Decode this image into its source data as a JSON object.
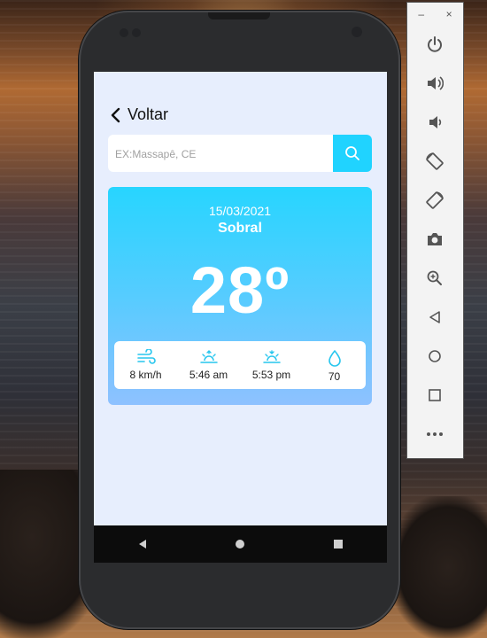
{
  "app": {
    "back_label": "Voltar",
    "search": {
      "placeholder": "EX:Massapê, CE",
      "value": ""
    },
    "weather": {
      "date": "15/03/2021",
      "city": "Sobral",
      "temperature": "28º",
      "stats": [
        {
          "icon": "wind-icon",
          "value": "8 km/h"
        },
        {
          "icon": "sunrise-icon",
          "value": "5:46 am"
        },
        {
          "icon": "sunset-icon",
          "value": "5:53 pm"
        },
        {
          "icon": "humidity-icon",
          "value": "70"
        }
      ]
    }
  },
  "colors": {
    "accent": "#20d3ff",
    "screen_bg": "#e7eefd",
    "card_gradient_top": "#27d5ff",
    "card_gradient_bottom": "#8ec1ff"
  },
  "emulator_panel": {
    "window_controls": [
      "–",
      "×"
    ],
    "tools": [
      "power-icon",
      "volume-up-icon",
      "volume-down-icon",
      "rotate-left-icon",
      "rotate-right-icon",
      "camera-icon",
      "zoom-icon",
      "back-icon",
      "home-icon",
      "overview-icon",
      "more-icon"
    ]
  }
}
